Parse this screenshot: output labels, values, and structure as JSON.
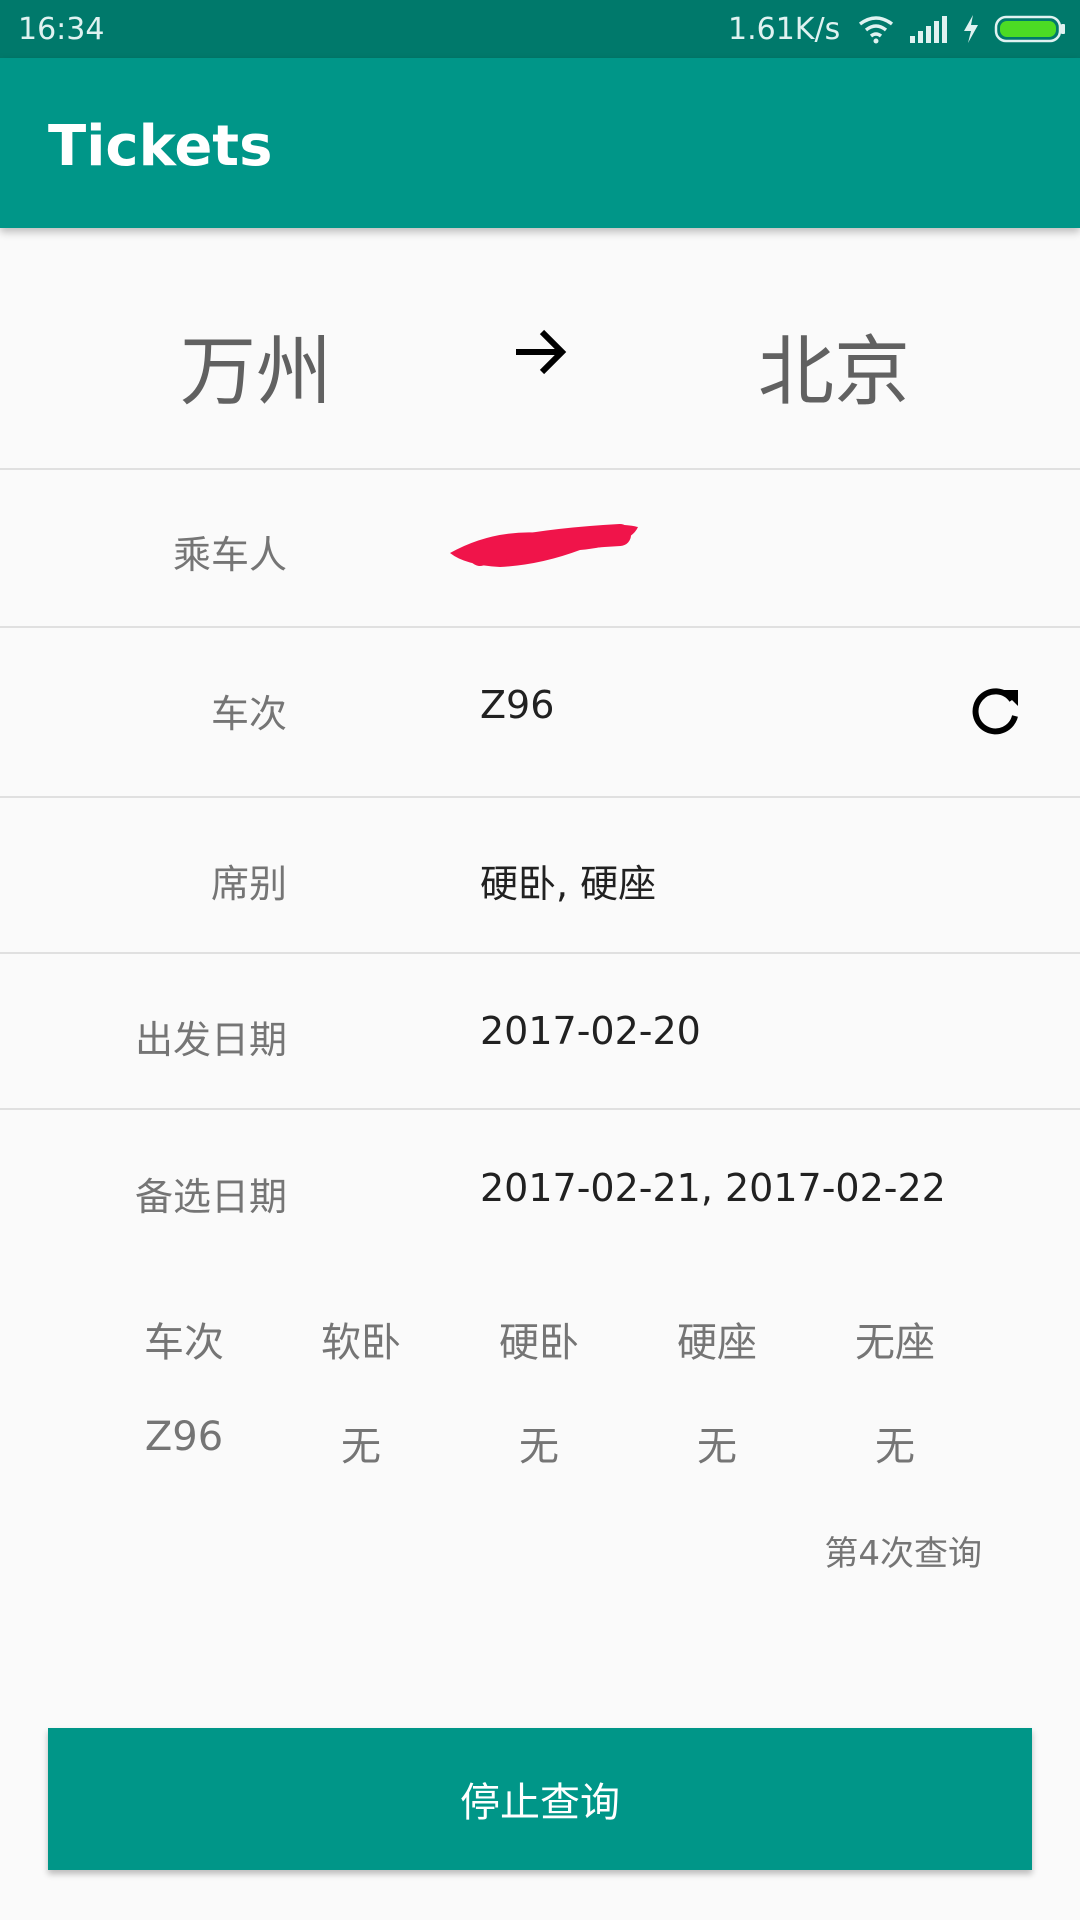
{
  "status_bar": {
    "time": "16:34",
    "network_speed": "1.61K/s",
    "icons": [
      "wifi-icon",
      "signal-icon",
      "charging-icon",
      "battery-icon"
    ]
  },
  "app_bar": {
    "title": "Tickets"
  },
  "route": {
    "from": "万州",
    "to": "北京",
    "arrow_icon": "arrow-right-icon"
  },
  "form": {
    "passenger": {
      "label": "乘车人"
    },
    "train": {
      "label": "车次",
      "value": "Z96",
      "refresh_icon": "refresh-icon"
    },
    "seat": {
      "label": "席别",
      "value": "硬卧, 硬座"
    },
    "date": {
      "label": "出发日期",
      "value": "2017-02-20"
    },
    "alt_dates": {
      "label": "备选日期",
      "value": "2017-02-21, 2017-02-22"
    }
  },
  "result_table": {
    "headers": [
      "车次",
      "软卧",
      "硬卧",
      "硬座",
      "无座"
    ],
    "rows": [
      [
        "Z96",
        "无",
        "无",
        "无",
        "无"
      ]
    ]
  },
  "query_count": "第4次查询",
  "stop_button": {
    "label": "停止查询"
  },
  "colors": {
    "primary": "#009688",
    "primary_dark": "#00796b",
    "redaction": "#f0144a",
    "battery": "#4cdb24"
  }
}
